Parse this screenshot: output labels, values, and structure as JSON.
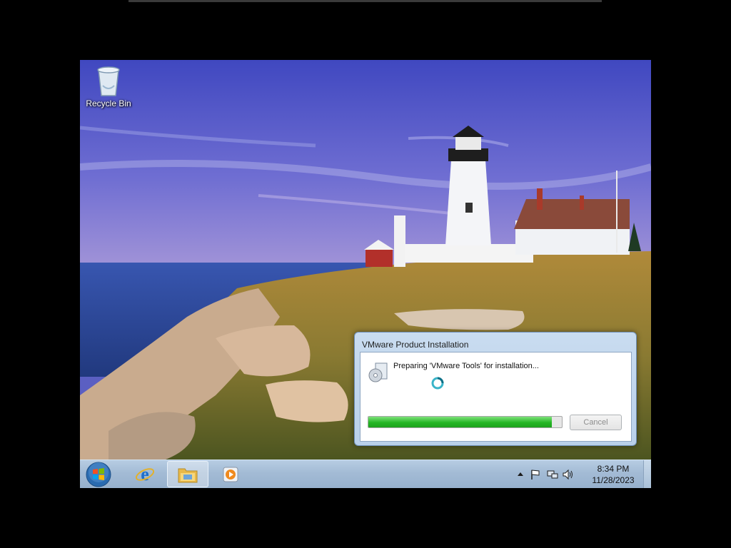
{
  "desktop": {
    "icons": [
      {
        "label": "Recycle Bin",
        "icon": "recycle-bin-icon"
      }
    ]
  },
  "dialog": {
    "title": "VMware Product Installation",
    "message": "Preparing 'VMware Tools' for installation...",
    "progress_fraction": 0.95,
    "cancel_label": "Cancel",
    "cancel_enabled": false,
    "icon": "installer-disc-icon"
  },
  "taskbar": {
    "buttons": [
      {
        "name": "start-button",
        "icon": "windows-logo-icon"
      },
      {
        "name": "internet-explorer-button",
        "icon": "internet-explorer-icon"
      },
      {
        "name": "windows-explorer-button",
        "icon": "folder-icon",
        "active": true
      },
      {
        "name": "media-player-button",
        "icon": "media-player-icon"
      }
    ],
    "tray_icons": [
      "show-hidden-icons-arrow",
      "action-center-flag-icon",
      "network-icon",
      "volume-icon"
    ],
    "clock": {
      "time": "8:34 PM",
      "date": "11/28/2023"
    }
  },
  "colors": {
    "progress": "#25b625",
    "taskbar": "#a3bbd5",
    "sky": "#5b5fc2",
    "sea": "#2e4fa3"
  }
}
